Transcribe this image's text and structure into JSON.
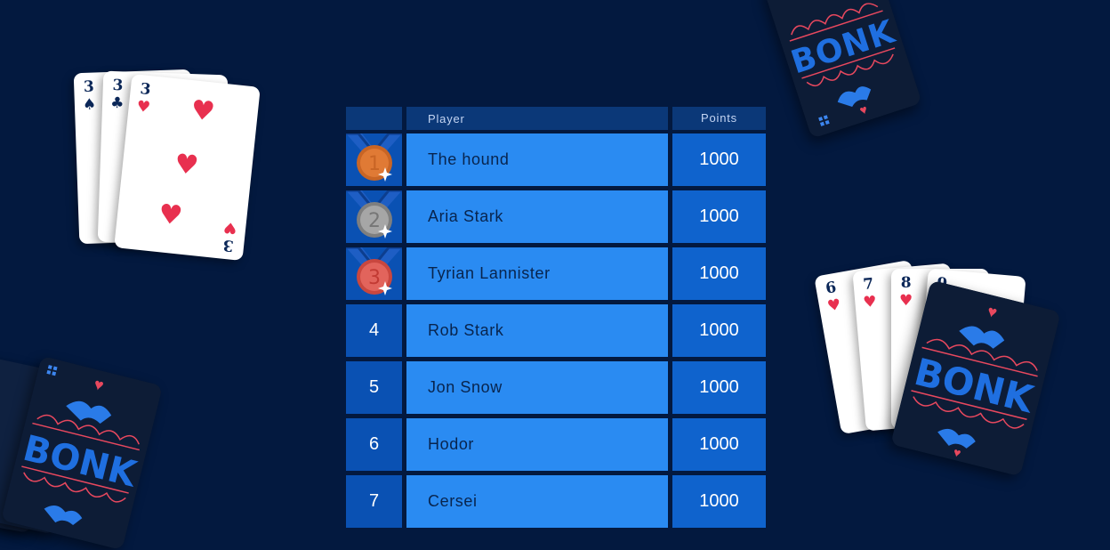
{
  "header": {
    "rank_label": "",
    "player_label": "Player",
    "points_label": "Points"
  },
  "rows": [
    {
      "rank": "1",
      "medal": "bronze-medal-icon",
      "player": "The hound",
      "points": "1000"
    },
    {
      "rank": "2",
      "medal": "silver-medal-icon",
      "player": "Aria Stark",
      "points": "1000"
    },
    {
      "rank": "3",
      "medal": "red-medal-icon",
      "player": "Tyrian Lannister",
      "points": "1000"
    },
    {
      "rank": "4",
      "player": "Rob Stark",
      "points": "1000"
    },
    {
      "rank": "5",
      "player": "Jon Snow",
      "points": "1000"
    },
    {
      "rank": "6",
      "player": "Hodor",
      "points": "1000"
    },
    {
      "rank": "7",
      "player": "Cersei",
      "points": "1000"
    }
  ],
  "hand_left": [
    {
      "rank": "3",
      "suit": "♠",
      "color": "#0b2758"
    },
    {
      "rank": "3",
      "suit": "♣",
      "color": "#0b2758"
    },
    {
      "rank": "3",
      "suit": "♥",
      "color": "#e8304f"
    }
  ],
  "hand_right": [
    {
      "rank": "6",
      "suit": "♥"
    },
    {
      "rank": "7",
      "suit": "♥"
    },
    {
      "rank": "8",
      "suit": "♥"
    },
    {
      "rank": "9",
      "suit": "♥"
    }
  ],
  "card_back_logo": "BONK",
  "colors": {
    "background": "#03193f",
    "header": "#0b3878",
    "rank_cell": "#0a51b3",
    "name_cell": "#2a8bf2",
    "points_cell": "#0f63cd",
    "bronze": "#e07a35",
    "silver": "#9a9a9a",
    "red_medal": "#e2645c"
  }
}
